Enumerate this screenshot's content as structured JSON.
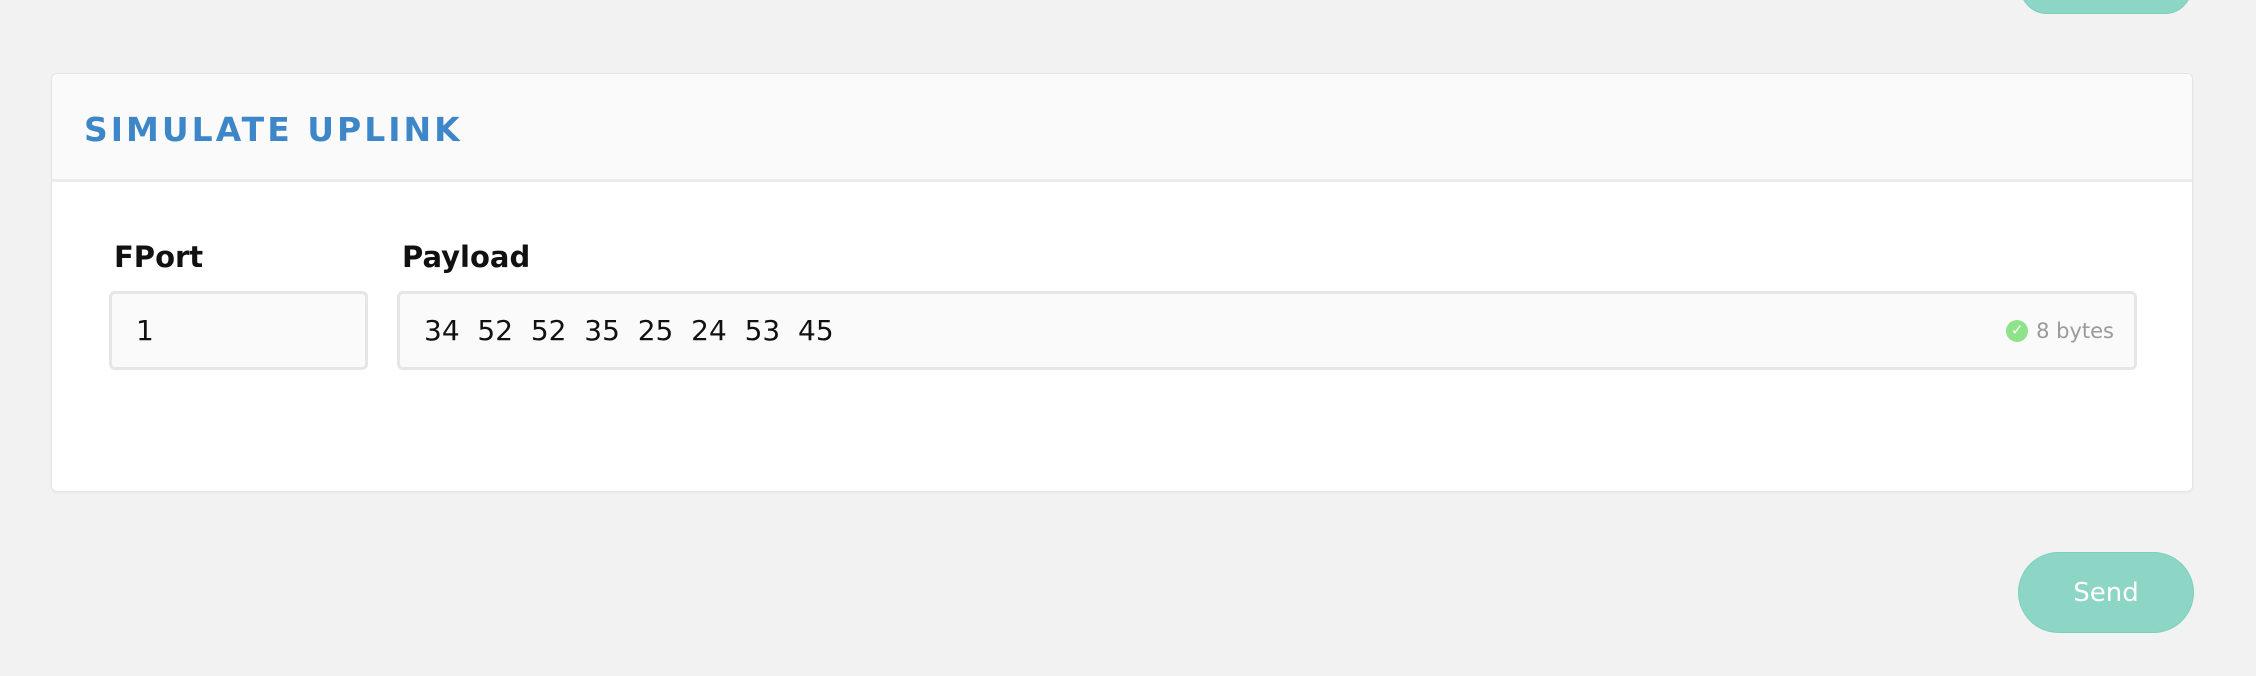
{
  "card": {
    "title": "SIMULATE UPLINK"
  },
  "fport": {
    "label": "FPort",
    "value": "1"
  },
  "payload": {
    "label": "Payload",
    "value": "34  52  52  35  25  24  53  45",
    "status_icon": "check-circle-icon",
    "byte_count": "8 bytes"
  },
  "actions": {
    "send_label": "Send"
  },
  "colors": {
    "accent_title": "#3d87c9",
    "button_teal": "#8dd6c6",
    "valid_green": "#8ee28a",
    "page_background": "#f2f2f2"
  }
}
